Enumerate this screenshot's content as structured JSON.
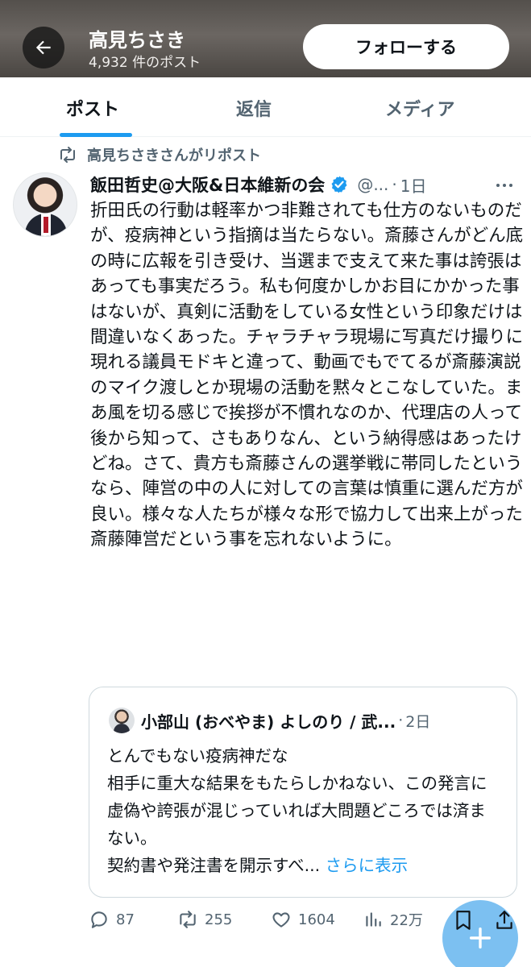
{
  "header": {
    "name": "高見ちさき",
    "post_count": "4,932 件のポスト",
    "follow_label": "フォローする"
  },
  "tabs": [
    {
      "label": "ポスト",
      "active": true
    },
    {
      "label": "返信",
      "active": false
    },
    {
      "label": "メディア",
      "active": false
    }
  ],
  "repost_note": "高見ちさきさんがリポスト",
  "tweet": {
    "author": "飯田哲史@大阪&日本維新の会",
    "handle": "@...",
    "time": "1日",
    "body": "折田氏の行動は軽率かつ非難されても仕方のないものだが、疫病神という指摘は当たらない。斎藤さんがどん底の時に広報を引き受け、当選まで支えて来た事は誇張はあっても事実だろう。私も何度かしかお目にかかった事はないが、真剣に活動をしている女性という印象だけは間違いなくあった。チャラチャラ現場に写真だけ撮りに現れる議員モドキと違って、動画でもでてるが斎藤演説のマイク渡しとか現場の活動を黙々とこなしていた。まあ風を切る感じで挨拶が不慣れなのか、代理店の人って後から知って、さもありなん、という納得感はあったけどね。さて、貴方も斎藤さんの選挙戦に帯同したというなら、陣営の中の人に対しての言葉は慎重に選んだ方が良い。様々な人たちが様々な形で協力して出来上がった斎藤陣営だという事を忘れないように。",
    "verified_color": "#1d9bf0"
  },
  "quote": {
    "author": "小部山 (おべやま) よしのり / 武...",
    "time": "2日",
    "body": "とんでもない疫病神だな\n相手に重大な結果をもたらしかねない、この発言に虚偽や誇張が混じっていれば大問題どころでは済まない。\n契約書や発注書を開示すべ...",
    "show_more": "さらに表示"
  },
  "actions": {
    "replies": "87",
    "reposts": "255",
    "likes": "1604",
    "views": "22万"
  },
  "colors": {
    "accent": "#1d9bf0",
    "fab": "#7cc0f1",
    "muted_text": "#536471"
  },
  "icons": [
    "back-arrow-icon",
    "repost-icon",
    "verified-badge-icon",
    "more-dots-icon",
    "reply-icon",
    "like-icon",
    "views-icon",
    "bookmark-icon",
    "share-icon",
    "compose-plus-icon"
  ]
}
